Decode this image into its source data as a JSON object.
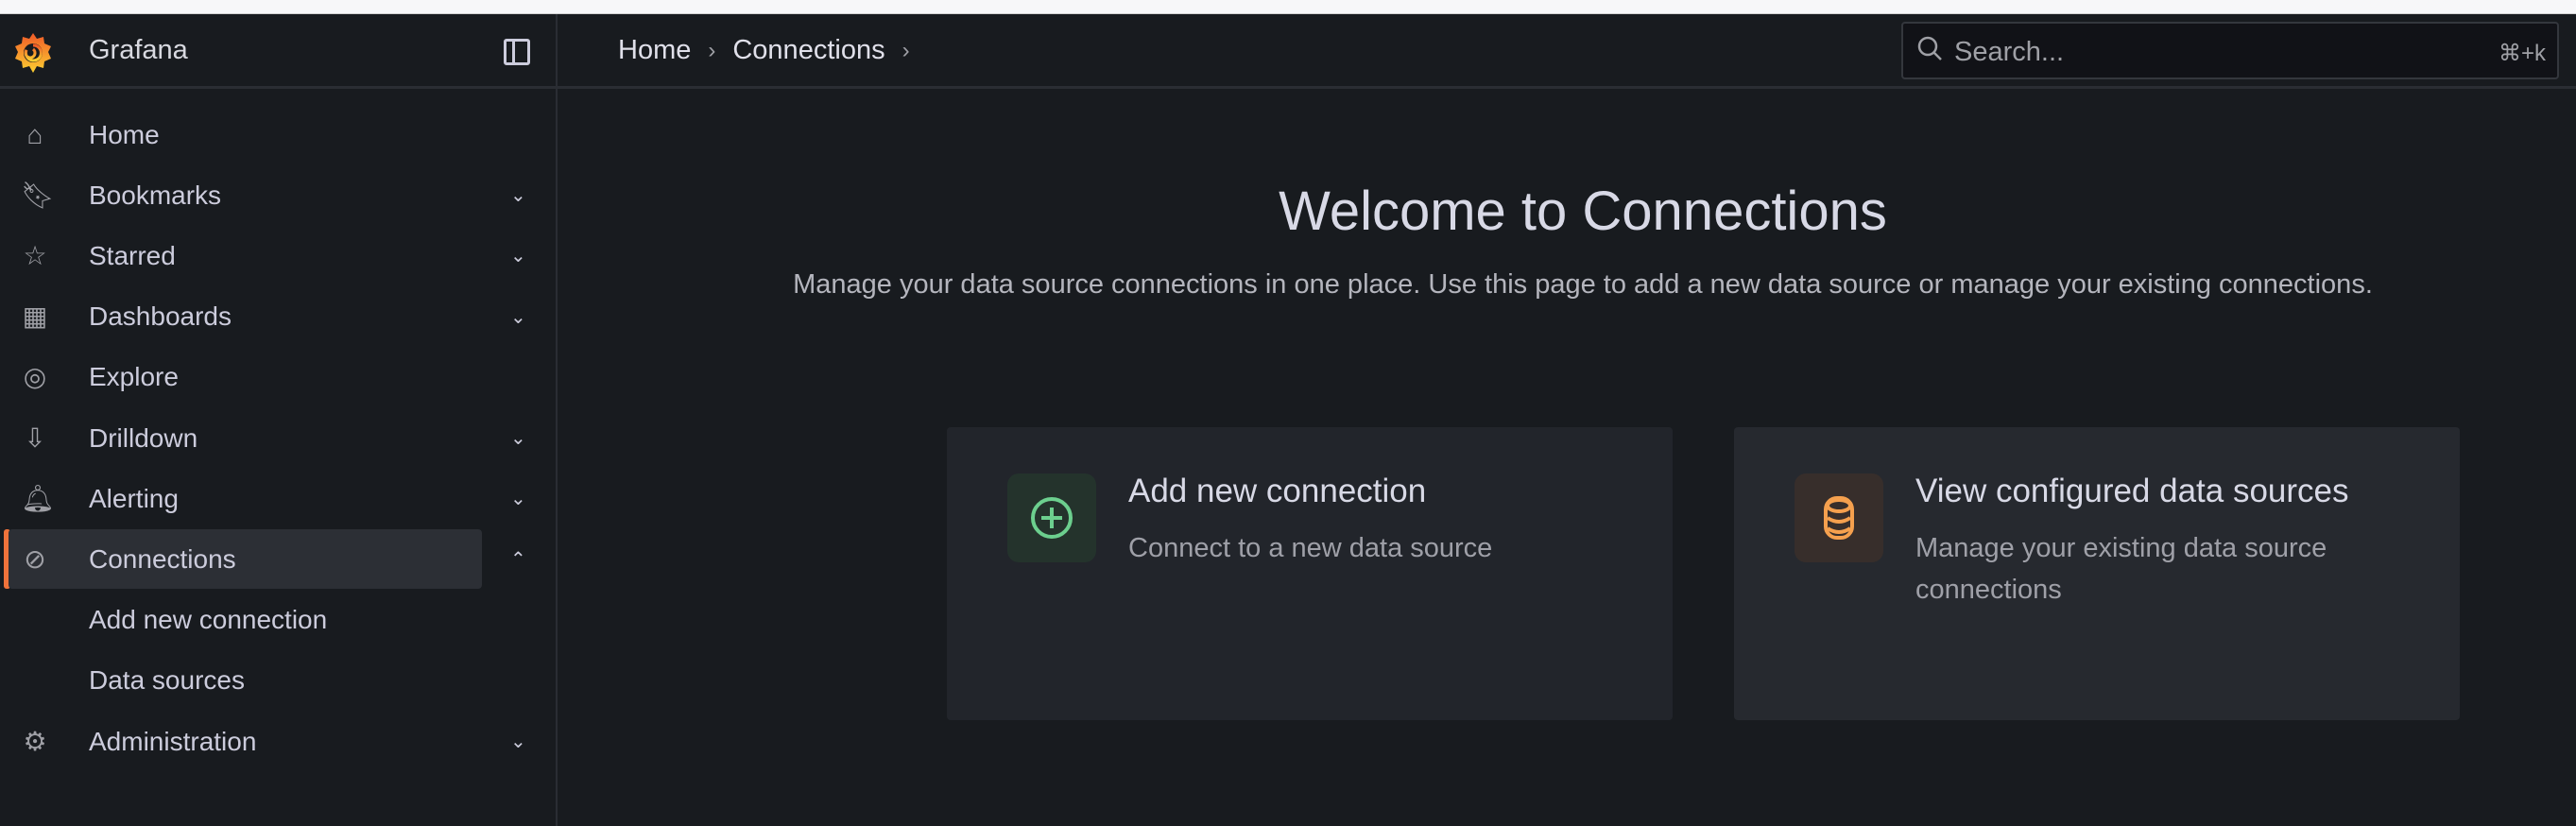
{
  "app": {
    "brand": "Grafana"
  },
  "sidebar": {
    "items": [
      {
        "label": "Home",
        "icon": "home-icon",
        "chevron": ""
      },
      {
        "label": "Bookmarks",
        "icon": "bookmark-icon",
        "chevron": "⌄"
      },
      {
        "label": "Starred",
        "icon": "star-icon",
        "chevron": "⌄"
      },
      {
        "label": "Dashboards",
        "icon": "apps-icon",
        "chevron": "⌄"
      },
      {
        "label": "Explore",
        "icon": "compass-icon",
        "chevron": ""
      },
      {
        "label": "Drilldown",
        "icon": "drilldown-icon",
        "chevron": "⌄"
      },
      {
        "label": "Alerting",
        "icon": "bell-icon",
        "chevron": "⌄"
      },
      {
        "label": "Connections",
        "icon": "link-icon",
        "chevron": "⌃",
        "active": true
      },
      {
        "label": "Add new connection",
        "sub": true
      },
      {
        "label": "Data sources",
        "sub": true
      },
      {
        "label": "Administration",
        "icon": "cog-icon",
        "chevron": "⌄"
      }
    ]
  },
  "header": {
    "breadcrumbs": [
      "Home",
      "Connections"
    ],
    "search_placeholder": "Search...",
    "search_shortcut": "⌘+k"
  },
  "main": {
    "title": "Welcome to Connections",
    "subtitle": "Manage your data source connections in one place. Use this page to add a new data source or manage your existing connections.",
    "cards": [
      {
        "title": "Add new connection",
        "description": "Connect to a new data source",
        "icon": "add-circle-icon",
        "color": "#6ccf8e"
      },
      {
        "title": "View configured data sources",
        "description": "Manage your existing data source connections",
        "icon": "database-icon",
        "color": "#f5a04e"
      }
    ]
  },
  "colors": {
    "accent": "#f0733b",
    "background": "#181b1f",
    "card": "#22252b"
  }
}
